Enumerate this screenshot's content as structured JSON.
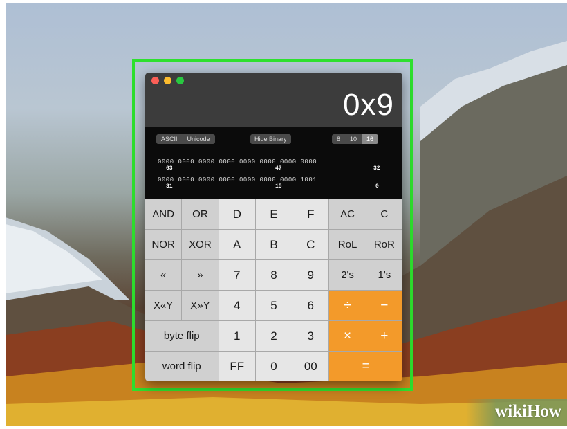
{
  "window": {
    "display_value": "0x9",
    "traffic_lights": [
      "close",
      "minimize",
      "zoom"
    ]
  },
  "binary_panel": {
    "ascii_label": "ASCII",
    "unicode_label": "Unicode",
    "hide_binary_label": "Hide Binary",
    "base_options": [
      "8",
      "10",
      "16"
    ],
    "selected_base": "16",
    "rows": [
      {
        "bits": "0000 0000 0000 0000 0000 0000 0000 0000",
        "left_index": "63",
        "mid_index": "47",
        "right_index": "32"
      },
      {
        "bits": "0000 0000 0000 0000 0000 0000 0000 1001",
        "left_index": "31",
        "mid_index": "15",
        "right_index": "0"
      }
    ]
  },
  "keys": {
    "and": "AND",
    "or": "OR",
    "d": "D",
    "e": "E",
    "f": "F",
    "ac": "AC",
    "c": "C",
    "nor": "NOR",
    "xor": "XOR",
    "a": "A",
    "b": "B",
    "c_hex": "C",
    "rol": "RoL",
    "ror": "RoR",
    "shift_left": "«",
    "shift_right": "»",
    "seven": "7",
    "eight": "8",
    "nine": "9",
    "twos": "2's",
    "ones": "1's",
    "x_shl_y": "X«Y",
    "x_shr_y": "X»Y",
    "four": "4",
    "five": "5",
    "six": "6",
    "divide": "÷",
    "minus": "−",
    "byte_flip": "byte flip",
    "one": "1",
    "two": "2",
    "three": "3",
    "multiply": "×",
    "plus": "+",
    "word_flip": "word flip",
    "ff": "FF",
    "zero": "0",
    "double_zero": "00",
    "equals": "="
  },
  "colors": {
    "highlight": "#2ee02e",
    "operator_key": "#f39a2a",
    "window_bg": "#3c3c3c"
  },
  "watermark": "wikiHow"
}
